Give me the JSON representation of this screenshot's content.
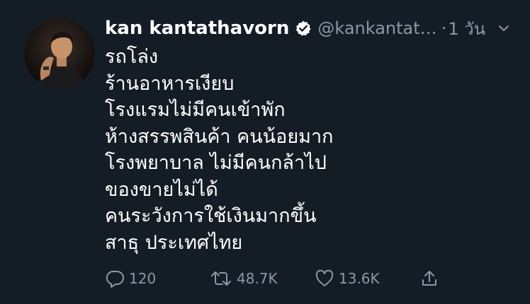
{
  "tweet": {
    "display_name": "kan kantathavorn",
    "handle": "@kankantat…",
    "separator": "·",
    "time": "1 วัน",
    "lines": [
      "รถโล่ง",
      "ร้านอาหารเงียบ",
      "โรงแรมไม่มีคนเข้าพัก",
      "ห้างสรรพสินค้า คนน้อยมาก",
      "โรงพยาบาล ไม่มีคนกล้าไป",
      "ของขายไม่ได้",
      "คนระวังการใช้เงินมากขึ้น",
      "สาธุ ประเทศไทย"
    ]
  },
  "actions": {
    "reply_count": "120",
    "retweet_count": "48.7K",
    "like_count": "13.6K"
  },
  "colors": {
    "background": "#141d26",
    "text": "#ffffff",
    "secondary": "#8899a6"
  },
  "icons": [
    "verified-badge-icon",
    "chevron-down-icon",
    "reply-icon",
    "retweet-icon",
    "like-icon",
    "share-icon"
  ]
}
